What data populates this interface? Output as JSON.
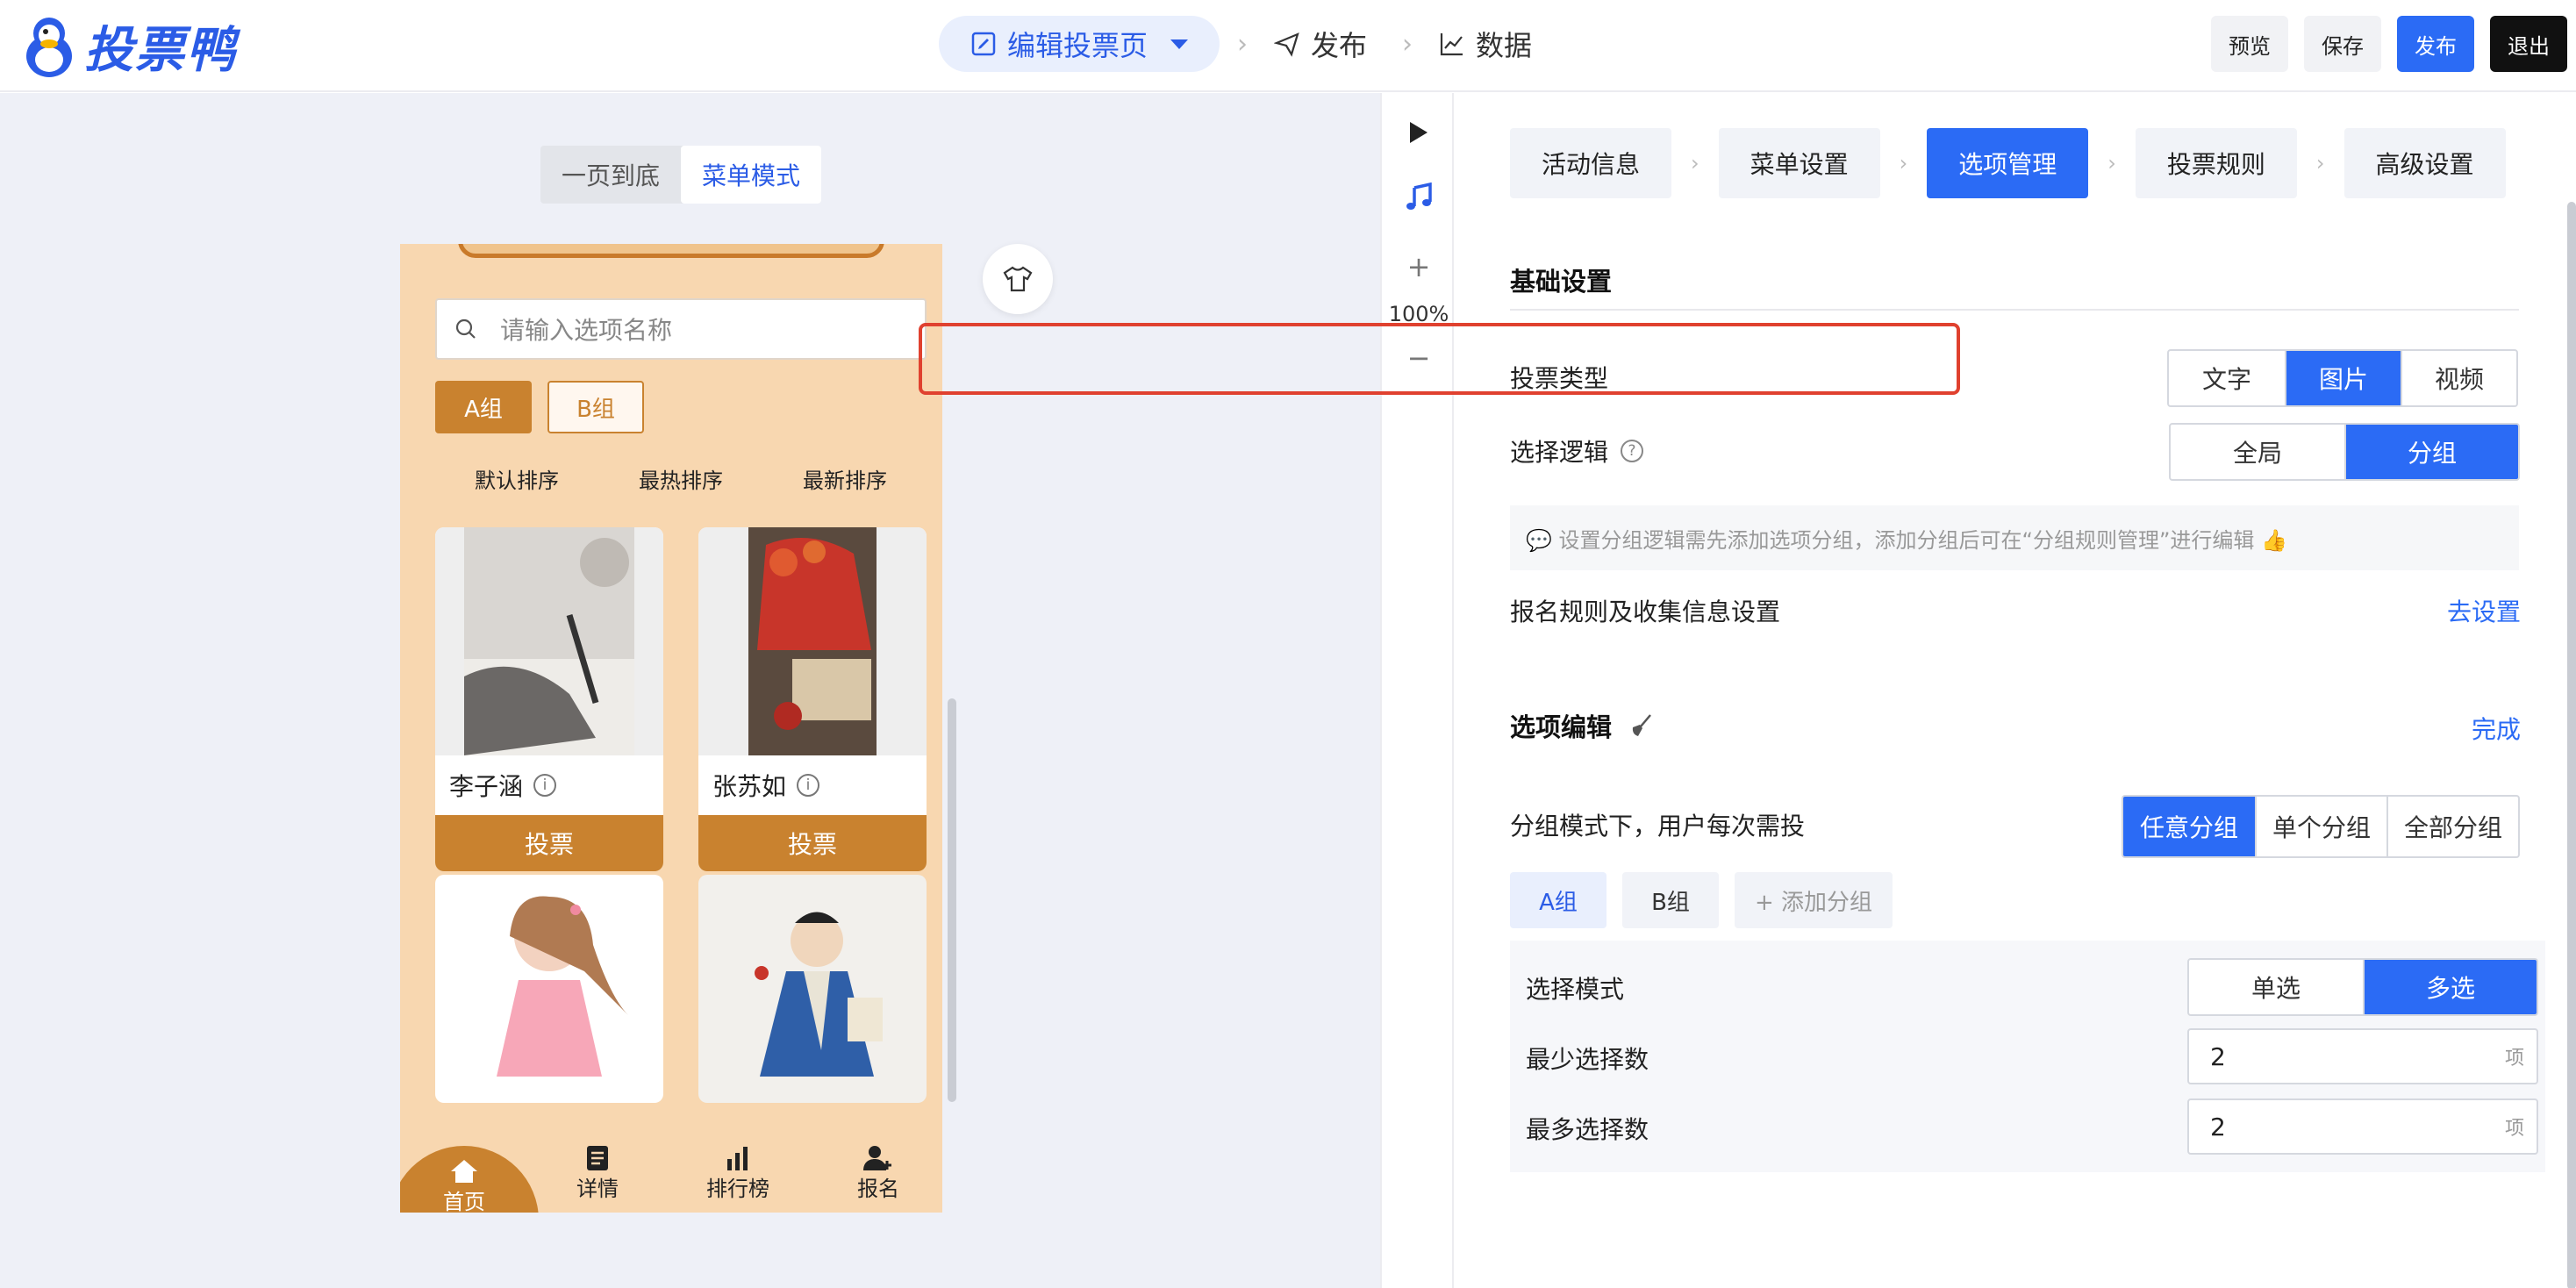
{
  "header": {
    "logo_text": "投票鸭",
    "nav_edit": "编辑投票页",
    "nav_publish": "发布",
    "nav_data": "数据",
    "btn_preview": "预览",
    "btn_save": "保存",
    "btn_publish": "发布",
    "btn_exit": "退出"
  },
  "canvas": {
    "mode_onepage": "一页到底",
    "mode_menu": "菜单模式",
    "search_placeholder": "请输入选项名称",
    "group_a": "A组",
    "group_b": "B组",
    "sort_default": "默认排序",
    "sort_hot": "最热排序",
    "sort_new": "最新排序",
    "cards": [
      {
        "name": "李子涵",
        "vote": "投票"
      },
      {
        "name": "张苏如",
        "vote": "投票"
      }
    ],
    "tabs": {
      "home": "首页",
      "detail": "详情",
      "rank": "排行榜",
      "signup": "报名"
    }
  },
  "tools": {
    "zoom": "100%",
    "plus": "+",
    "minus": "−"
  },
  "panel": {
    "steps": [
      "活动信息",
      "菜单设置",
      "选项管理",
      "投票规则",
      "高级设置"
    ],
    "basic_title": "基础设置",
    "vote_type_label": "投票类型",
    "vote_types": [
      "文字",
      "图片",
      "视频"
    ],
    "logic_label": "选择逻辑",
    "logic_options": [
      "全局",
      "分组"
    ],
    "hint": "💬 设置分组逻辑需先添加选项分组，添加分组后可在“分组规则管理”进行编辑 👍",
    "signup_rule_label": "报名规则及收集信息设置",
    "signup_rule_link": "去设置",
    "edit_title": "选项编辑",
    "edit_done": "完成",
    "group_mode_label": "分组模式下，用户每次需投",
    "group_modes": [
      "任意分组",
      "单个分组",
      "全部分组"
    ],
    "group_tabs": [
      "A组",
      "B组"
    ],
    "add_group": "+ 添加分组",
    "select_mode_label": "选择模式",
    "select_modes": [
      "单选",
      "多选"
    ],
    "min_label": "最少选择数",
    "min_value": "2",
    "max_label": "最多选择数",
    "max_value": "2",
    "unit": "项"
  }
}
